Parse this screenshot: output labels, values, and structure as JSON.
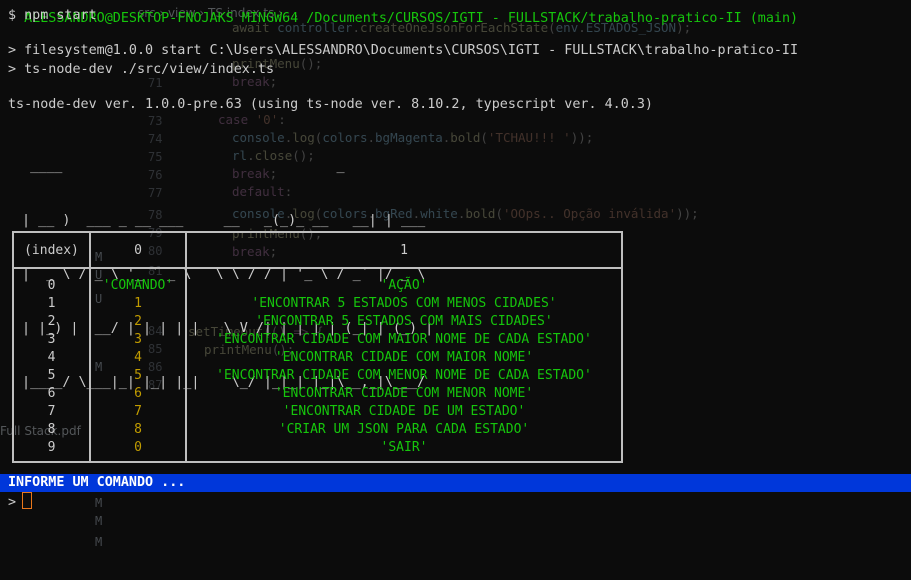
{
  "terminal": {
    "top_line": "ALESSANDRO@DESKTOP-FNOJAKS MINGW64 /Documents/CURSOS/IGTI - FULLSTACK/trabalho-pratico-II (main)",
    "command": "$ npm start",
    "npm_line1": "> filesystem@1.0.0 start C:\\Users\\ALESSANDRO\\Documents\\CURSOS\\IGTI - FULLSTACK\\trabalho-pratico-II",
    "npm_line2": "> ts-node-dev ./src/view/index.ts",
    "version_line": "ts-node-dev ver. 1.0.0-pre.63 (using ts-node ver. 8.10.2, typescript ver. 4.0.3)",
    "ascii_art": [
      "  ____                                  _           ",
      " | __ )  ___ _ __ ___     __   _(_)_ __   __| | ___  ",
      " |  _ \\ / _ \\ '_ ` _ \\   \\ \\ / / | '_ \\ / _` |/ _ \\ ",
      " | |_) |  __/ | | | | |   \\ V /| | | | | (_| | (_) |",
      " |____/ \\___|_| |_| |_|    \\_/ |_|_| |_|\\__,_|\\___/ "
    ],
    "table": {
      "headers": [
        "(index)",
        "0",
        "1"
      ],
      "rows": [
        [
          "0",
          "'COMANDO'",
          "'AÇÃO'"
        ],
        [
          "1",
          "1",
          "'ENCONTRAR 5 ESTADOS COM MENOS CIDADES'"
        ],
        [
          "2",
          "2",
          "'ENCONTRAR 5 ESTADOS COM MAIS CIDADES'"
        ],
        [
          "3",
          "3",
          "'ENCONTRAR CIDADE COM MAIOR NOME DE CADA ESTADO'"
        ],
        [
          "4",
          "4",
          "'ENCONTRAR CIDADE COM MAIOR NOME'"
        ],
        [
          "5",
          "5",
          "'ENCONTRAR CIDADE COM MENOR NOME DE CADA ESTADO'"
        ],
        [
          "6",
          "6",
          "'ENCONTRAR CIDADE COM MENOR NOME'"
        ],
        [
          "7",
          "7",
          "'ENCONTRAR CIDADE DE UM ESTADO'"
        ],
        [
          "8",
          "8",
          "'CRIAR UM JSON PARA CADA ESTADO'"
        ],
        [
          "9",
          "0",
          "'SAIR'"
        ]
      ]
    },
    "banner": "INFORME UM COMANDO ...",
    "input_prompt": ">",
    "input_value": ""
  },
  "background_editor": {
    "breadcrumb": "src › view › TS index.ts › ...",
    "file_label": "Full Stack.pdf"
  },
  "colors": {
    "terminal_bg": "#0c0c0c",
    "banner_bg": "#0037da",
    "green": "#16c60c",
    "yellow": "#c19c00",
    "cursor": "#e8761b"
  }
}
